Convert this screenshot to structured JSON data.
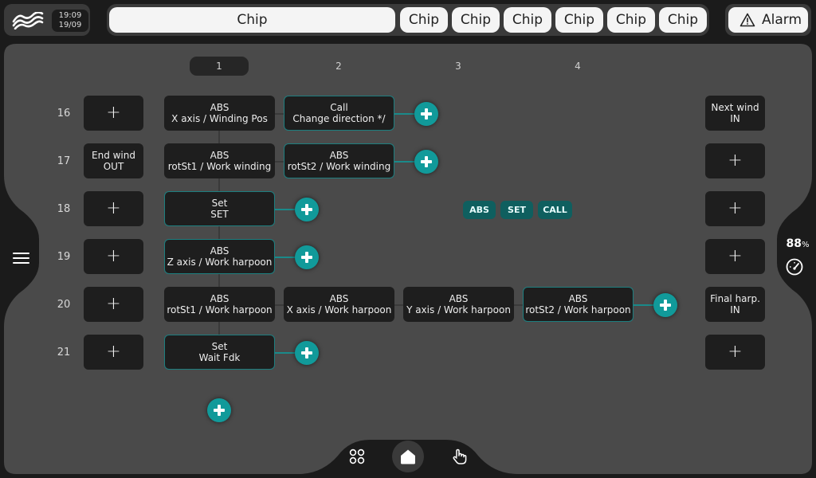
{
  "header": {
    "time": "19:09",
    "date": "19/09",
    "chips": [
      "Chip",
      "Chip",
      "Chip",
      "Chip",
      "Chip",
      "Chip",
      "Chip"
    ],
    "alarm_label": "Alarm"
  },
  "columns": [
    "1",
    "2",
    "3",
    "4"
  ],
  "rows": [
    {
      "num": "16",
      "left": "+",
      "right_l1": "Next wind",
      "right_l2": "IN"
    },
    {
      "num": "17",
      "left_l1": "End wind",
      "left_l2": "OUT",
      "right": "+"
    },
    {
      "num": "18",
      "left": "+",
      "right": "+"
    },
    {
      "num": "19",
      "left": "+",
      "right": "+"
    },
    {
      "num": "20",
      "left": "+",
      "right_l1": "Final harp.",
      "right_l2": "IN"
    },
    {
      "num": "21",
      "left": "+",
      "right": "+"
    }
  ],
  "steps": {
    "r16c1": {
      "l1": "ABS",
      "l2": "X axis / Winding Pos"
    },
    "r16c2": {
      "l1": "Call",
      "l2": "Change direction */"
    },
    "r17c1": {
      "l1": "ABS",
      "l2": "rotSt1 / Work winding"
    },
    "r17c2": {
      "l1": "ABS",
      "l2": "rotSt2 / Work winding"
    },
    "r18c1": {
      "l1": "Set",
      "l2": "SET"
    },
    "r19c1": {
      "l1": "ABS",
      "l2": "Z axis / Work harpoon"
    },
    "r20c1": {
      "l1": "ABS",
      "l2": "rotSt1 / Work harpoon"
    },
    "r20c2": {
      "l1": "ABS",
      "l2": "X axis / Work harpoon"
    },
    "r20c3": {
      "l1": "ABS",
      "l2": "Y axis / Work harpoon"
    },
    "r20c4": {
      "l1": "ABS",
      "l2": "rotSt2 / Work harpoon"
    },
    "r21c1": {
      "l1": "Set",
      "l2": "Wait Fdk"
    }
  },
  "tags": [
    "ABS",
    "SET",
    "CALL"
  ],
  "side": {
    "percent": "88",
    "percent_unit": "%"
  },
  "icons": {
    "logo": "wave-logo-icon",
    "alarm": "warning-triangle-icon",
    "menu": "hamburger-menu-icon",
    "speed": "speedometer-icon",
    "apps": "apps-grid-icon",
    "home": "home-icon",
    "manual": "hand-pointer-icon"
  },
  "colors": {
    "accent": "#119a9a",
    "panel": "#4a4a4a",
    "background": "#1b1b1b",
    "card": "#1e1e1e"
  }
}
